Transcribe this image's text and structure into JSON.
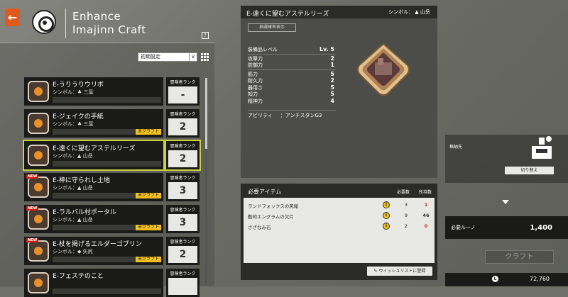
{
  "header": {
    "back_label": "←",
    "title_line1": "Enhance",
    "title_line2": "Imajinn Craft",
    "help": "?"
  },
  "sort": {
    "selected": "初期設定",
    "arrow": "∨"
  },
  "cards": [
    {
      "name": "E-うりうりウリボ",
      "symbol": "シンボル：",
      "symbol_name": "三葉",
      "new": "",
      "mikraft": "",
      "rank_label": "冒険者ランク",
      "rank": "-"
    },
    {
      "name": "E-ジェイクの手紙",
      "symbol": "シンボル：",
      "symbol_name": "三葉",
      "new": "",
      "mikraft": "未クラフト",
      "rank_label": "冒険者ランク",
      "rank": "2"
    },
    {
      "name": "E-遠くに望むアステルリーズ",
      "symbol": "シンボル：",
      "symbol_name": "山岳",
      "new": "",
      "mikraft": "",
      "rank_label": "冒険者ランク",
      "rank": "2"
    },
    {
      "name": "E-神に守られし土地",
      "symbol": "シンボル：",
      "symbol_name": "山岳",
      "new": "NEW",
      "mikraft": "未クラフト",
      "rank_label": "冒険者ランク",
      "rank": "3"
    },
    {
      "name": "E-ラルバル村ポータル",
      "symbol": "シンボル：",
      "symbol_name": "山岳",
      "new": "NEW",
      "mikraft": "未クラフト",
      "rank_label": "冒険者ランク",
      "rank": "3"
    },
    {
      "name": "E-杖を掲げるエルダーゴブリン",
      "symbol": "シンボル：",
      "symbol_name": "矢尻",
      "new": "NEW",
      "mikraft": "未クラフト",
      "rank_label": "冒険者ランク",
      "rank": "2"
    },
    {
      "name": "E-フェステのこと",
      "symbol": "",
      "symbol_name": "",
      "new": "",
      "mikraft": "",
      "rank_label": "冒険者ランク",
      "rank": ""
    }
  ],
  "detail": {
    "title": "E-遠くに望むアステルリーズ",
    "symbol": "シンボル：",
    "symbol_name": "山岳",
    "prob_button": "抽選確率表示",
    "level_label": "装備品レベル",
    "level_value": "Lv. 5",
    "stats": [
      {
        "k": "攻撃力",
        "v": "2"
      },
      {
        "k": "防御力",
        "v": "1"
      }
    ],
    "stats2": [
      {
        "k": "筋力",
        "v": "5"
      },
      {
        "k": "耐久力",
        "v": "2"
      },
      {
        "k": "器用さ",
        "v": "5"
      },
      {
        "k": "知力",
        "v": "5"
      },
      {
        "k": "精神力",
        "v": "4"
      }
    ],
    "ability_label": "アビリティ",
    "ability_value": "：アンチスタンG3"
  },
  "items": {
    "title": "必要アイテム",
    "qty_header": "必要数",
    "have_header": "所持数",
    "rows": [
      {
        "name": "ランドフォックスの尻尾",
        "info": "i",
        "qty": "3",
        "have": "1",
        "have_color": "#d02020"
      },
      {
        "name": "勤的エングラムの欠片",
        "info": "i",
        "qty": "9",
        "have": "46",
        "have_color": "#333333"
      },
      {
        "name": "さざなみ石",
        "info": "i",
        "qty": "2",
        "have": "0",
        "have_color": "#d02020"
      }
    ],
    "wishlist": "ウィッシュリストに登録"
  },
  "right": {
    "store_label": "格納先",
    "switch_label": "切り替え",
    "rune_label": "必要ルーノ",
    "rune_value": "1,400",
    "craft_label": "クラフト",
    "coin_icon": "L",
    "coin_value": "72,760"
  }
}
